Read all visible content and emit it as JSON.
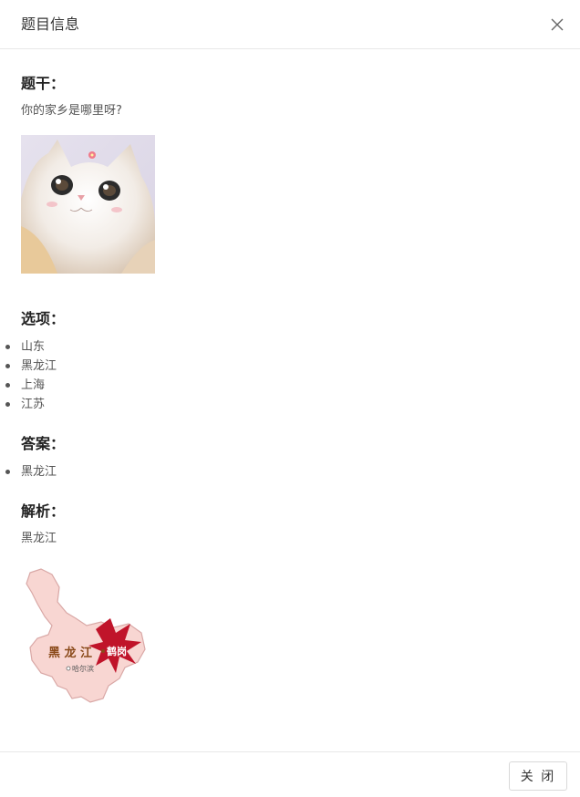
{
  "dialog": {
    "title": "题目信息",
    "close_icon": "close-icon"
  },
  "stem": {
    "label": "题干：",
    "question": "你的家乡是哪里呀?",
    "image": "cat-photo"
  },
  "options": {
    "label": "选项：",
    "items": [
      "山东",
      "黑龙江",
      "上海",
      "江苏"
    ]
  },
  "answer": {
    "label": "答案：",
    "items": [
      "黑龙江"
    ]
  },
  "analysis": {
    "label": "解析：",
    "text": "黑龙江",
    "image": "heilongjiang-map",
    "map_labels": {
      "province": "黑 龙 江",
      "city": "哈尔滨",
      "badge": "鹤岗"
    }
  },
  "footer": {
    "close_label": "关 闭"
  }
}
